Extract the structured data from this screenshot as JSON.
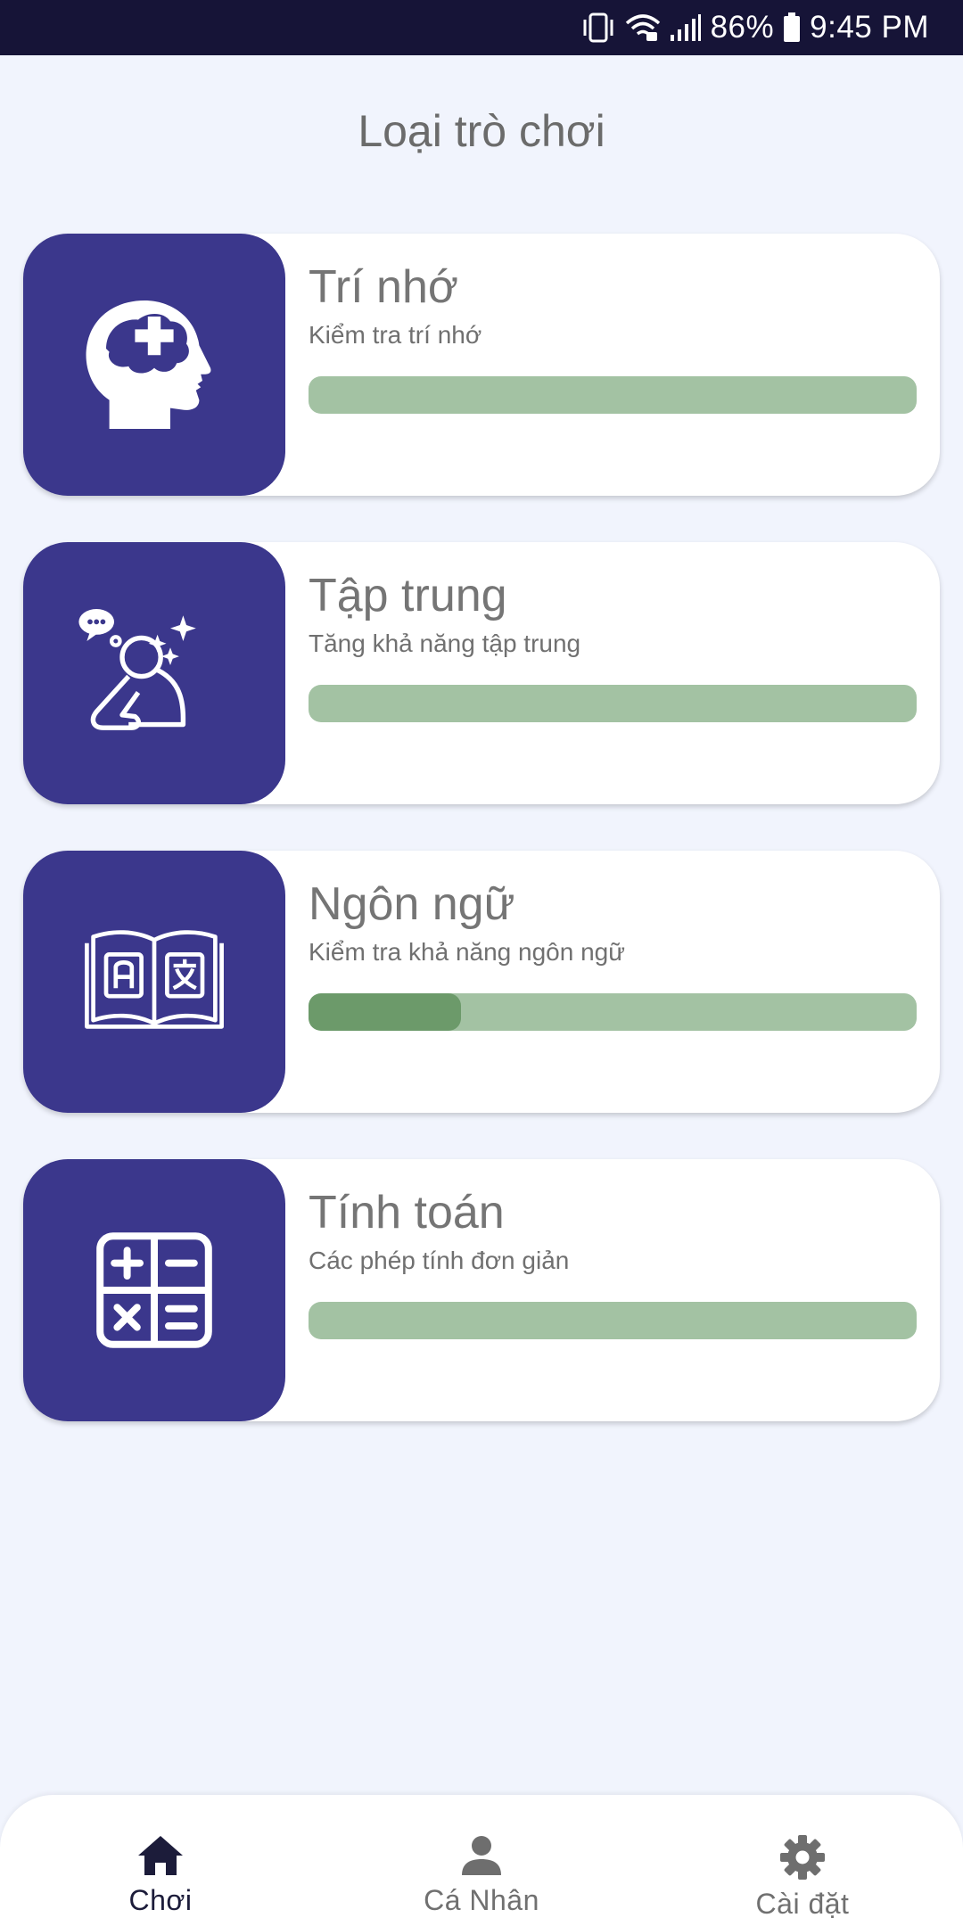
{
  "status_bar": {
    "battery": "86%",
    "time": "9:45 PM"
  },
  "page_title": "Loại trò chơi",
  "games": [
    {
      "title": "Trí nhớ",
      "subtitle": "Kiểm tra trí nhớ",
      "progress": 0.0,
      "icon": "brain-head-icon"
    },
    {
      "title": "Tập trung",
      "subtitle": "Tăng khả năng tập trung",
      "progress": 0.0,
      "icon": "thinking-person-icon"
    },
    {
      "title": "Ngôn ngữ",
      "subtitle": "Kiểm tra khả năng ngôn ngữ",
      "progress": 0.25,
      "icon": "translate-book-icon"
    },
    {
      "title": "Tính toán",
      "subtitle": "Các phép tính đơn giản",
      "progress": 0.0,
      "icon": "calculator-icon"
    }
  ],
  "bottom_nav": {
    "items": [
      {
        "label": "Chơi",
        "icon": "home-icon",
        "active": true
      },
      {
        "label": "Cá Nhân",
        "icon": "person-icon",
        "active": false
      },
      {
        "label": "Cài đặt",
        "icon": "gear-icon",
        "active": false
      }
    ]
  },
  "colors": {
    "status_bar": "#161437",
    "background": "#f1f4fd",
    "icon_box": "#3b378c",
    "progress_track": "#a3c2a3",
    "progress_fill": "#6c9a6a"
  }
}
